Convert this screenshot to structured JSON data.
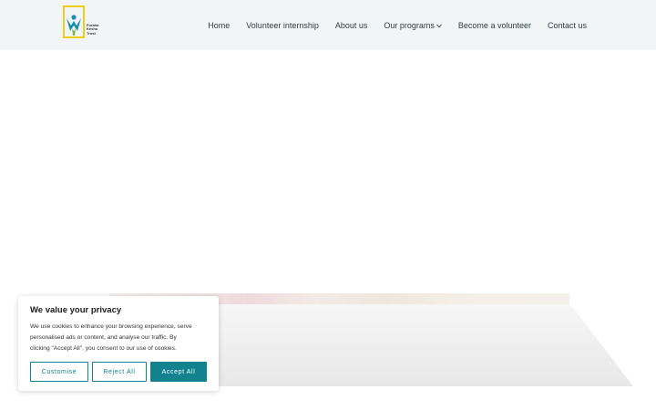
{
  "header": {
    "logo": {
      "icon": "logo-figure-icon",
      "text": [
        "Furaha",
        "Kesho",
        "Trust"
      ],
      "colors": {
        "frame": "#f2cc1b",
        "figure_blue": "#1b8fb0",
        "figure_green": "#7bb53a"
      }
    },
    "nav": [
      {
        "label": "Home"
      },
      {
        "label": "Volunteer internship"
      },
      {
        "label": "About us"
      },
      {
        "label": "Our programs",
        "has_dropdown": true
      },
      {
        "label": "Become a volunteer"
      },
      {
        "label": "Contact us"
      }
    ],
    "colors": {
      "background": "#f1f5f6",
      "text": "#2f3d47"
    }
  },
  "cookie_banner": {
    "title": "We value your privacy",
    "text_lines": [
      "We use cookies to enhance your browsing experience, serve",
      "personalised ads or content, and analyse our traffic. By",
      "clicking \"Accept All\", you consent to our use of cookies."
    ],
    "buttons": {
      "customise": "Customise",
      "reject": "Reject All",
      "accept": "Accept All"
    },
    "colors": {
      "accent": "#12828f"
    }
  }
}
